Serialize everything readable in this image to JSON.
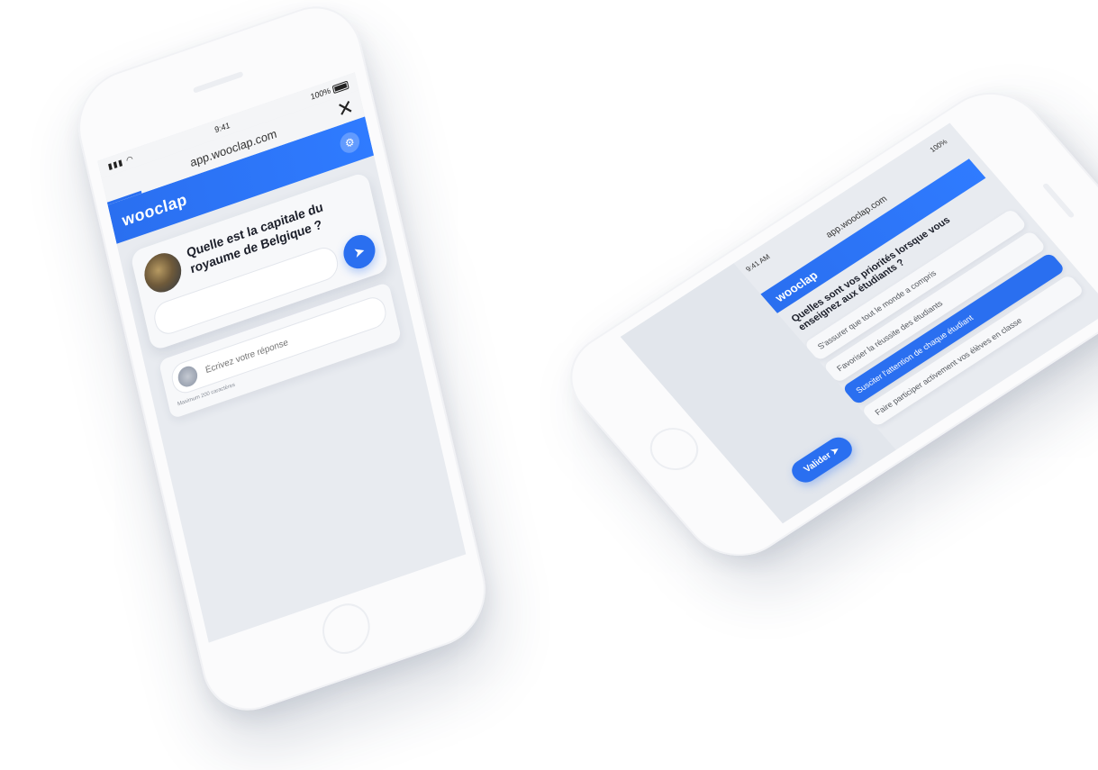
{
  "colors": {
    "accent": "#2a6ff0",
    "phone_body": "#fbfbfc",
    "screen_bg": "#e8ebf0"
  },
  "phone_portrait": {
    "status": {
      "time": "9:41",
      "battery": "100%"
    },
    "url": "app.wooclap.com",
    "close_glyph": "✕",
    "app_logo": "wooclap",
    "settings_icon": "gear-icon",
    "question": "Quelle est la capitale du royaume de Belgique ?",
    "send_icon": "send-icon",
    "answer_placeholder": "Écrivez votre réponse",
    "char_count": "Maximum 200 caractères"
  },
  "phone_landscape": {
    "status": {
      "time": "9:41 AM",
      "battery": "100%"
    },
    "url": "app.wooclap.com",
    "app_logo": "wooclap",
    "question": "Quelles sont vos priorités lorsque vous enseignez aux étudiants ?",
    "options": [
      {
        "label": "S'assurer que tout le monde a compris",
        "selected": false
      },
      {
        "label": "Favoriser la réussite des étudiants",
        "selected": false
      },
      {
        "label": "Susciter l'attention de chaque étudiant",
        "selected": true
      },
      {
        "label": "Faire participer activement vos élèves en classe",
        "selected": false
      }
    ],
    "validate_label": "Valider"
  }
}
